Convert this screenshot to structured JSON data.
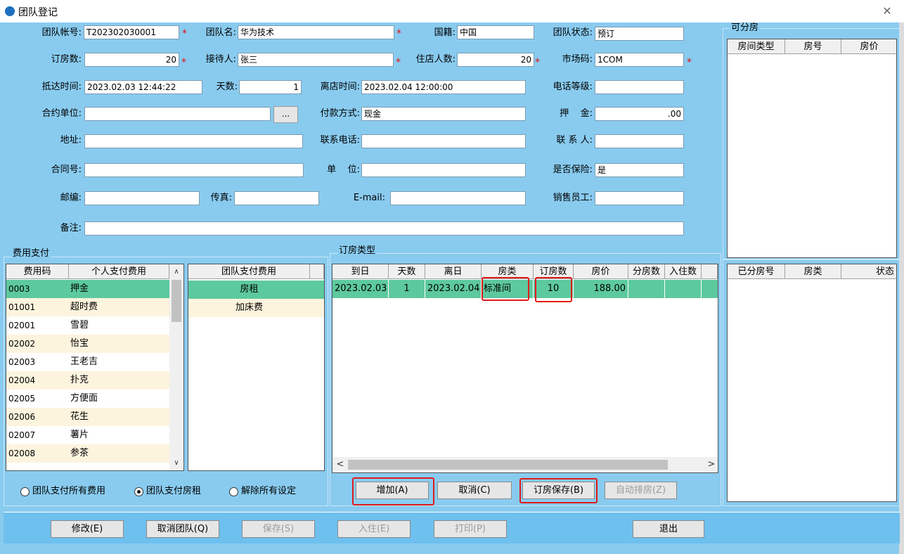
{
  "window": {
    "title": "团队登记",
    "close_glyph": "✕"
  },
  "form": {
    "team_account": {
      "label": "团队帐号:",
      "value": "T202302030001"
    },
    "team_name": {
      "label": "团队名:",
      "value": "华为技术"
    },
    "nationality": {
      "label": "国籍:",
      "value": "中国"
    },
    "team_status": {
      "label": "团队状态:",
      "value": "预订"
    },
    "rooms_booked": {
      "label": "订房数:",
      "value": "20"
    },
    "receptionist": {
      "label": "接待人:",
      "value": "张三"
    },
    "guests": {
      "label": "住店人数:",
      "value": "20"
    },
    "market_code": {
      "label": "市场码:",
      "value": "1COM"
    },
    "arrival": {
      "label": "抵达时间:",
      "value": "2023.02.03 12:44:22"
    },
    "days": {
      "label": "天数:",
      "value": "1"
    },
    "departure": {
      "label": "离店时间:",
      "value": "2023.02.04 12:00:00"
    },
    "phone_level": {
      "label": "电话等级:",
      "value": ""
    },
    "contract_unit": {
      "label": "合约单位:",
      "value": "",
      "button": "..."
    },
    "payment": {
      "label": "付款方式:",
      "value": "现金"
    },
    "deposit": {
      "label": "押    金:",
      "value": ".00"
    },
    "address": {
      "label": "地址:",
      "value": ""
    },
    "contact_phone": {
      "label": "联系电话:",
      "value": ""
    },
    "contact_person": {
      "label": "联 系 人:",
      "value": ""
    },
    "contract_no": {
      "label": "合同号:",
      "value": ""
    },
    "unit": {
      "label": "单    位:",
      "value": ""
    },
    "insured": {
      "label": "是否保险:",
      "value": "是"
    },
    "postcode": {
      "label": "邮编:",
      "value": ""
    },
    "fax": {
      "label": "传真:",
      "value": ""
    },
    "email": {
      "label": "E-mail:",
      "value": ""
    },
    "sales": {
      "label": "销售员工:",
      "value": ""
    },
    "remark": {
      "label": "备注:",
      "value": ""
    },
    "required_mark": "*"
  },
  "fees": {
    "title": "费用支付",
    "personal_headers": [
      "费用码",
      "个人支付费用"
    ],
    "personal_rows": [
      {
        "code": "0003",
        "name": "押金"
      },
      {
        "code": "01001",
        "name": "超时费"
      },
      {
        "code": "02001",
        "name": "雪碧"
      },
      {
        "code": "02002",
        "name": "怡宝"
      },
      {
        "code": "02003",
        "name": "王老吉"
      },
      {
        "code": "02004",
        "name": "扑克"
      },
      {
        "code": "02005",
        "name": "方便面"
      },
      {
        "code": "02006",
        "name": "花生"
      },
      {
        "code": "02007",
        "name": "薯片"
      },
      {
        "code": "02008",
        "name": "参茶"
      }
    ],
    "team_header": "团队支付费用",
    "team_rows": [
      "房租",
      "加床费"
    ],
    "options": [
      "团队支付所有费用",
      "团队支付房租",
      "解除所有设定"
    ],
    "selected_option": "团队支付房租"
  },
  "booking": {
    "title": "订房类型",
    "headers": [
      "到日",
      "天数",
      "离日",
      "房类",
      "订房数",
      "房价",
      "分房数",
      "入住数"
    ],
    "rows": [
      {
        "arrive": "2023.02.03",
        "days": "1",
        "leave": "2023.02.04",
        "type": "标准间",
        "count": "10",
        "price": "188.00",
        "assigned": "",
        "checked_in": ""
      }
    ],
    "buttons": {
      "add": "增加(A)",
      "cancel": "取消(C)",
      "save": "订房保存(B)",
      "auto": "自动排房(Z)"
    }
  },
  "available": {
    "title": "可分房",
    "headers": [
      "房间类型",
      "房号",
      "房价"
    ]
  },
  "assigned": {
    "headers": [
      "已分房号",
      "房类",
      "状态"
    ]
  },
  "bottom": {
    "modify": "修改(E)",
    "cancel_team": "取消团队(Q)",
    "save": "保存(S)",
    "checkin": "入住(E)",
    "print": "打印(P)",
    "exit": "退出"
  },
  "scroll": {
    "up": "∧",
    "down": "∨",
    "left": "<",
    "right": ">"
  },
  "colors": {
    "background": "#89cbef",
    "selected_row": "#5dc99e",
    "alt_row": "#fdf4de",
    "highlight": "#e11a1a"
  }
}
